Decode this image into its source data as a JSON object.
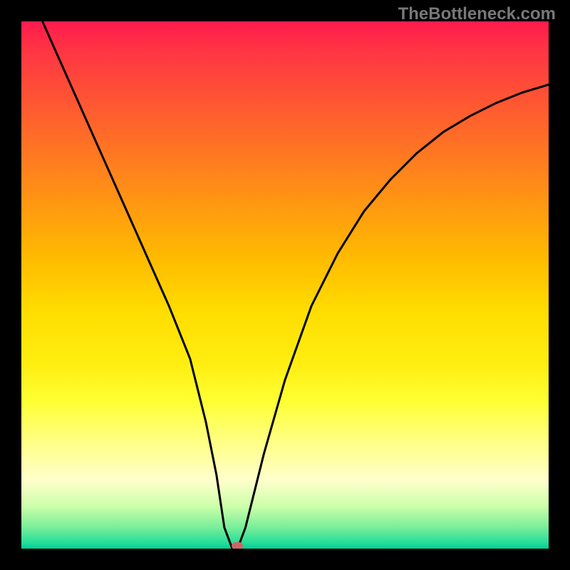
{
  "watermark": "TheBottleneck.com",
  "chart_data": {
    "type": "line",
    "title": "",
    "xlabel": "",
    "ylabel": "",
    "xlim": [
      0,
      100
    ],
    "ylim": [
      0,
      100
    ],
    "grid": false,
    "background": "rainbow-gradient-vertical",
    "series": [
      {
        "name": "bottleneck-curve",
        "x": [
          4,
          8,
          12,
          16,
          20,
          24,
          28,
          32,
          35,
          37,
          38.5,
          40,
          41,
          42.5,
          46,
          50,
          55,
          60,
          65,
          70,
          75,
          80,
          85,
          90,
          95,
          100
        ],
        "y": [
          100,
          91,
          82,
          73,
          64,
          55,
          46,
          36,
          24,
          14,
          4,
          0,
          0,
          4,
          18,
          32,
          46,
          56,
          64,
          70,
          75,
          79,
          82,
          84.5,
          86.5,
          88
        ]
      }
    ],
    "marker": {
      "x": 41,
      "y": 0.5,
      "color": "#cc6666"
    },
    "gradient_stops": [
      {
        "pos": 0,
        "color": "#ff1a4d"
      },
      {
        "pos": 5,
        "color": "#ff3344"
      },
      {
        "pos": 15,
        "color": "#ff5533"
      },
      {
        "pos": 25,
        "color": "#ff7722"
      },
      {
        "pos": 35,
        "color": "#ff9911"
      },
      {
        "pos": 45,
        "color": "#ffbb00"
      },
      {
        "pos": 55,
        "color": "#ffdd00"
      },
      {
        "pos": 65,
        "color": "#ffee11"
      },
      {
        "pos": 72,
        "color": "#ffff33"
      },
      {
        "pos": 80,
        "color": "#ffff88"
      },
      {
        "pos": 87,
        "color": "#ffffcc"
      },
      {
        "pos": 92,
        "color": "#ccffaa"
      },
      {
        "pos": 96,
        "color": "#77ee99"
      },
      {
        "pos": 99,
        "color": "#22dd99"
      },
      {
        "pos": 100,
        "color": "#00cc99"
      }
    ]
  }
}
